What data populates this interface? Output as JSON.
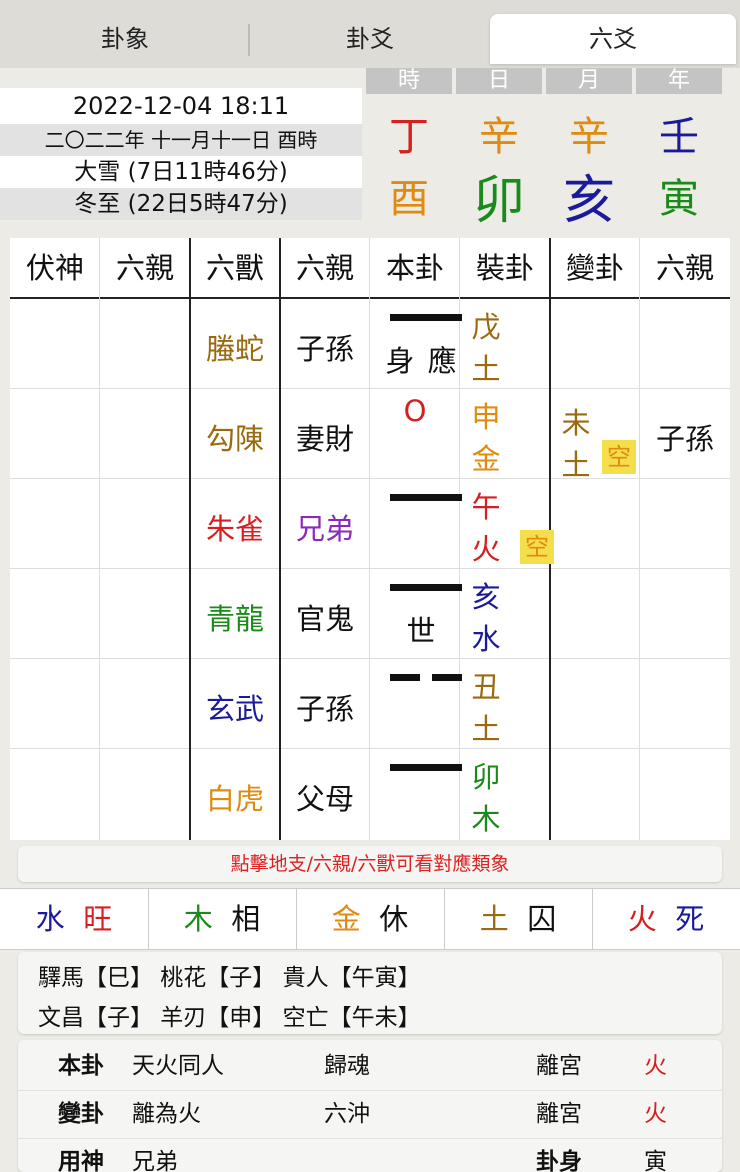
{
  "tabs": [
    "卦象",
    "卦爻",
    "六爻"
  ],
  "date": {
    "datetime": "2022-12-04 18:11",
    "lunar": "二〇二二年 十一月十一日 酉時",
    "term1": "大雪 (7日11時46分)",
    "term2": "冬至 (22日5時47分)"
  },
  "pillars": {
    "headers": [
      "時",
      "日",
      "月",
      "年"
    ],
    "stems": [
      "丁",
      "辛",
      "辛",
      "壬"
    ],
    "branches": [
      "酉",
      "卯",
      "亥",
      "寅"
    ],
    "stem_colors": [
      "#d42020",
      "#e08a10",
      "#e08a10",
      "#1a1a9a"
    ],
    "branch_colors": [
      "#e08a10",
      "#1a8a1a",
      "#1a1a9a",
      "#1a8a1a"
    ]
  },
  "table": {
    "headers": [
      "伏神",
      "六親",
      "六獸",
      "六親",
      "本卦",
      "裝卦",
      "變卦",
      "六親"
    ],
    "rows": [
      {
        "beast": "螣蛇",
        "beast_color": "#9a6a10",
        "relation": "子孫",
        "relation_color": "#111111",
        "line": "yang",
        "mark": "身 應",
        "moving": "",
        "stem": "戊",
        "element": "土",
        "najia_color": "#9a6a10",
        "empty": "",
        "change_stem": "",
        "change_element": "",
        "change_color": "#9a6a10",
        "change_empty": "",
        "change_relation": ""
      },
      {
        "beast": "勾陳",
        "beast_color": "#9a6a10",
        "relation": "妻財",
        "relation_color": "#111111",
        "line": "moving",
        "mark": "",
        "moving": "O",
        "stem": "申",
        "element": "金",
        "najia_color": "#e08a10",
        "empty": "",
        "change_stem": "未",
        "change_element": "土",
        "change_color": "#9a6a10",
        "change_empty": "空",
        "change_relation": "子孫"
      },
      {
        "beast": "朱雀",
        "beast_color": "#d42020",
        "relation": "兄弟",
        "relation_color": "#8a2ab8",
        "line": "yang",
        "mark": "",
        "moving": "",
        "stem": "午",
        "element": "火",
        "najia_color": "#d42020",
        "empty": "空",
        "change_stem": "",
        "change_element": "",
        "change_color": "#9a6a10",
        "change_empty": "",
        "change_relation": ""
      },
      {
        "beast": "青龍",
        "beast_color": "#1a8a1a",
        "relation": "官鬼",
        "relation_color": "#111111",
        "line": "yang",
        "mark": "世",
        "moving": "",
        "stem": "亥",
        "element": "水",
        "najia_color": "#1a1a9a",
        "empty": "",
        "change_stem": "",
        "change_element": "",
        "change_color": "#9a6a10",
        "change_empty": "",
        "change_relation": ""
      },
      {
        "beast": "玄武",
        "beast_color": "#1a1a9a",
        "relation": "子孫",
        "relation_color": "#111111",
        "line": "yin",
        "mark": "",
        "moving": "",
        "stem": "丑",
        "element": "土",
        "najia_color": "#9a6a10",
        "empty": "",
        "change_stem": "",
        "change_element": "",
        "change_color": "#9a6a10",
        "change_empty": "",
        "change_relation": ""
      },
      {
        "beast": "白虎",
        "beast_color": "#e08a10",
        "relation": "父母",
        "relation_color": "#111111",
        "line": "yang",
        "mark": "",
        "moving": "",
        "stem": "卯",
        "element": "木",
        "najia_color": "#1a8a1a",
        "empty": "",
        "change_stem": "",
        "change_element": "",
        "change_color": "#9a6a10",
        "change_empty": "",
        "change_relation": ""
      }
    ]
  },
  "hint": "點擊地支/六親/六獸可看對應類象",
  "wuxing": [
    {
      "element": "水",
      "element_color": "#1a1a9a",
      "state": "旺",
      "state_color": "#d42020"
    },
    {
      "element": "木",
      "element_color": "#1a8a1a",
      "state": "相",
      "state_color": "#111111"
    },
    {
      "element": "金",
      "element_color": "#e08a10",
      "state": "休",
      "state_color": "#111111"
    },
    {
      "element": "土",
      "element_color": "#9a6a10",
      "state": "囚",
      "state_color": "#111111"
    },
    {
      "element": "火",
      "element_color": "#d42020",
      "state": "死",
      "state_color": "#1a1a9a"
    }
  ],
  "shensha": {
    "row1": "驛馬【巳】 桃花【子】 貴人【午寅】",
    "row2": "文昌【子】 羊刃【申】 空亡【午未】"
  },
  "info": [
    {
      "label": "本卦",
      "name": "天火同人",
      "type": "歸魂",
      "palace": "離宮",
      "element": "火",
      "element_color": "#d42020"
    },
    {
      "label": "變卦",
      "name": "離為火",
      "type": "六沖",
      "palace": "離宮",
      "element": "火",
      "element_color": "#d42020"
    },
    {
      "label": "用神",
      "name": "兄弟",
      "type": "",
      "palace": "卦身",
      "element": "寅",
      "element_color": "#111111"
    }
  ]
}
